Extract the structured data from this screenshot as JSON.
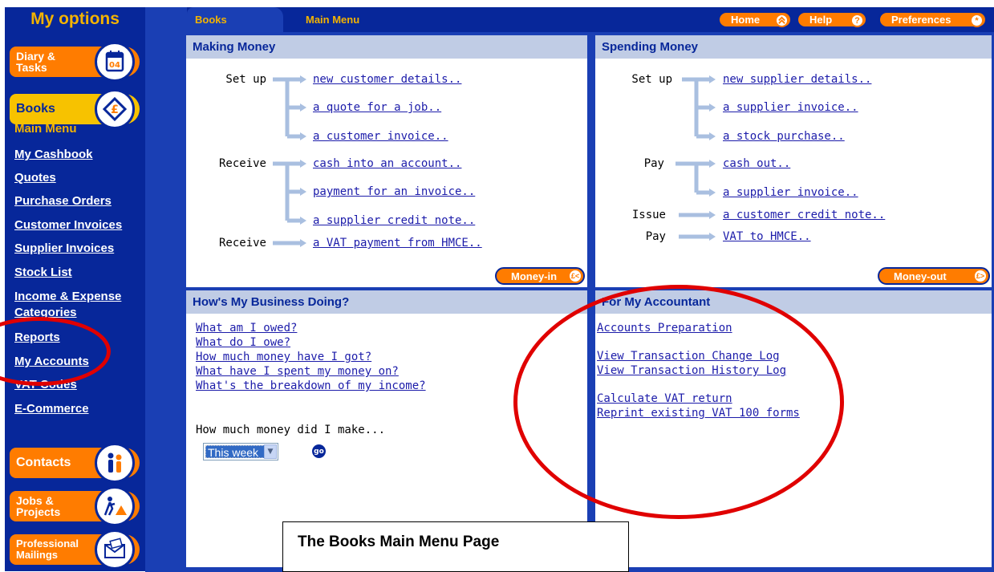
{
  "sidebar": {
    "title": "My options",
    "subtitle": "Main Menu",
    "pills": {
      "diary": {
        "label": "Diary & Tasks",
        "icon": "calendar-icon",
        "icon_text": "04"
      },
      "books": {
        "label": "Books",
        "icon": "pound-book-icon"
      },
      "contacts": {
        "label": "Contacts",
        "icon": "people-icon"
      },
      "jobs": {
        "label": "Jobs & Projects",
        "icon": "worker-icon"
      },
      "mailings": {
        "label": "Professional Mailings",
        "icon": "envelope-icon"
      }
    },
    "nav": [
      "My Cashbook",
      "Quotes",
      "Purchase Orders",
      "Customer Invoices",
      "Supplier Invoices",
      "Stock List",
      "Income & Expense Categories",
      "Reports",
      "My Accounts",
      "VAT Codes",
      "E-Commerce"
    ]
  },
  "header": {
    "tab_books": "Books",
    "tab_main_menu": "Main Menu",
    "buttons": {
      "home": "Home",
      "help": "Help",
      "help_icon_text": "?",
      "preferences": "Preferences",
      "preferences_icon_text": "*"
    }
  },
  "making_money": {
    "title": "Making Money",
    "labels": {
      "setup": "Set up",
      "receive": "Receive",
      "receive_vat": "Receive"
    },
    "links": [
      "new customer details..",
      "a quote for a job..",
      "a customer invoice..",
      "cash into an account..",
      "payment for an invoice..",
      "a supplier credit note..",
      "a VAT payment from HMCE.."
    ],
    "button": "Money-in",
    "button_icon_text": "£<"
  },
  "spending_money": {
    "title": "Spending Money",
    "labels": {
      "setup": "Set up",
      "pay": "Pay",
      "issue": "Issue",
      "pay_vat": "Pay"
    },
    "links": [
      "new supplier details..",
      "a supplier invoice..",
      "a stock purchase..",
      "cash out..",
      "a supplier invoice..",
      "a customer credit note..",
      "VAT to HMCE.."
    ],
    "button": "Money-out",
    "button_icon_text": "£>"
  },
  "business": {
    "title": "How's My Business Doing?",
    "links": [
      "What am I owed?",
      "What do I owe?",
      "How much money have I got?",
      "What have I spent my money on?",
      "What's the breakdown of my income?"
    ],
    "question": "How much money did I make...",
    "period": "This week",
    "go": "go"
  },
  "accountant": {
    "title": "For My Accountant",
    "links": [
      "Accounts Preparation",
      "View Transaction Change Log",
      "View Transaction History Log",
      "Calculate VAT return",
      "Reprint existing VAT 100 forms"
    ]
  },
  "caption": "The Books Main Menu Page",
  "colors": {
    "navy": "#07279a",
    "orange": "#ff7c00",
    "yellow": "#f7c200",
    "panel_header": "#c0cce5",
    "link": "#1c1caa",
    "annotation": "#e00000"
  }
}
